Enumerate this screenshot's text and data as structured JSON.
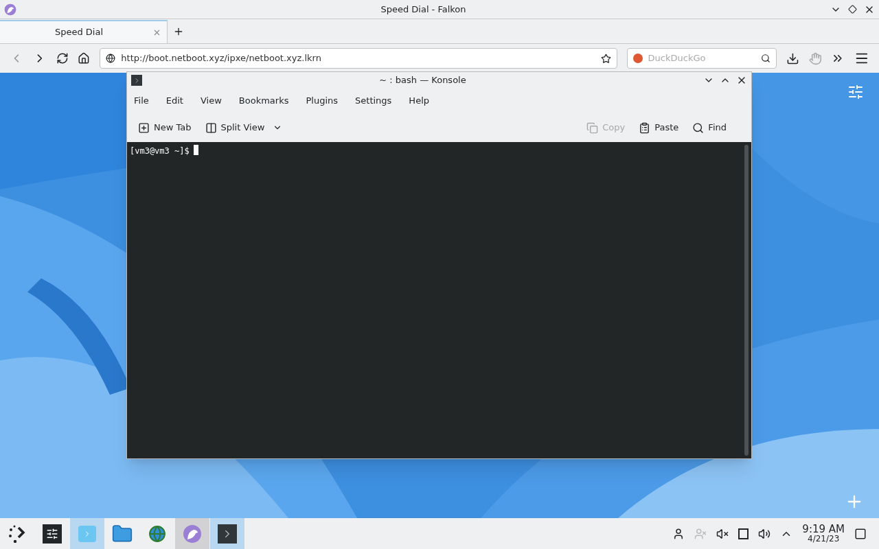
{
  "browser": {
    "title": "Speed Dial - Falkon",
    "tabs": [
      {
        "label": "Speed Dial",
        "selected": true
      }
    ],
    "url": "http://boot.netboot.xyz/ipxe/netboot.xyz.lkrn",
    "search": {
      "placeholder": "DuckDuckGo"
    }
  },
  "terminal_window": {
    "title": "~ : bash — Konsole",
    "menu": [
      "File",
      "Edit",
      "View",
      "Bookmarks",
      "Plugins",
      "Settings",
      "Help"
    ],
    "toolbar": [
      {
        "kind": "new-tab",
        "label": "New Tab",
        "disabled": false
      },
      {
        "kind": "split",
        "label": "Split View",
        "disabled": false
      },
      {
        "kind": "copy",
        "label": "Copy",
        "disabled": true
      },
      {
        "kind": "paste",
        "label": "Paste",
        "disabled": false
      },
      {
        "kind": "find",
        "label": "Find",
        "disabled": false
      }
    ],
    "prompt": "[vm3@vm3 ~]$"
  },
  "taskbar": {
    "items": [
      {
        "kind": "launcher",
        "selected": false,
        "hovered": false
      },
      {
        "kind": "settings",
        "selected": false,
        "hovered": false
      },
      {
        "kind": "files",
        "selected": true,
        "hovered": false
      },
      {
        "kind": "folder",
        "selected": false,
        "hovered": false
      },
      {
        "kind": "globe",
        "selected": false,
        "hovered": false
      },
      {
        "kind": "falkon",
        "selected": false,
        "hovered": true
      },
      {
        "kind": "konsole",
        "selected": true,
        "hovered": false
      }
    ],
    "time": "9:19 AM",
    "date": "4/21/23"
  }
}
